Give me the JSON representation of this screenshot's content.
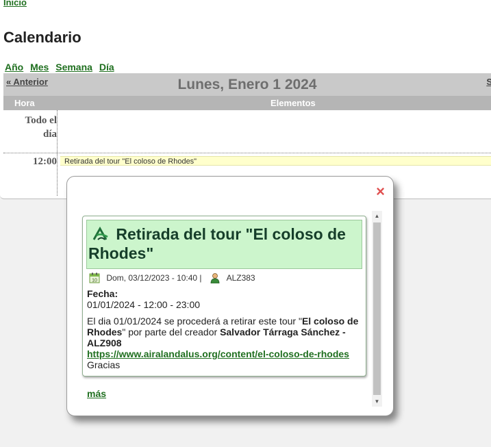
{
  "nav": {
    "inicio": "Inicio"
  },
  "page": {
    "title": "Calendario"
  },
  "views": [
    "Año",
    "Mes",
    "Semana",
    "Día"
  ],
  "navbar": {
    "prev": "« Anterior",
    "title": "Lunes, Enero 1 2024",
    "next": "S"
  },
  "columns": {
    "hora": "Hora",
    "elementos": "Elementos"
  },
  "rows": {
    "allday_line1": "Todo el",
    "allday_line2": "día",
    "time": "12:00"
  },
  "event": {
    "bar_text": "Retirada del tour \"El coloso de Rhodes\""
  },
  "popup": {
    "close": "×",
    "card_title": "Retirada del tour \"El coloso de Rhodes\"",
    "posted": "Dom, 03/12/2023 - 10:40 |",
    "user": "ALZ383",
    "fecha_label": "Fecha:",
    "fecha_value": "01/01/2024 - 12:00 - 23:00",
    "text1": "El dia 01/01/2024 se procederá a retirar este tour \"",
    "tour_name": "El coloso de Rhodes",
    "text2": "\" por parte del creador ",
    "creator": "Salvador Tárraga Sánchez - ALZ908",
    "link": "https://www.airalandalus.org/content/el-coloso-de-rhodes",
    "thanks": "Gracias",
    "more": "más"
  },
  "icons": {
    "close": "close-icon",
    "logo": "leaf-logo-icon",
    "calendar": "calendar-icon",
    "user": "user-icon"
  },
  "colors": {
    "link": "#1f6f1f",
    "header_bg": "#c9c9c9",
    "card_head_bg": "#ccf5cc",
    "event_bg": "#ffffcc",
    "close": "#e05050"
  }
}
